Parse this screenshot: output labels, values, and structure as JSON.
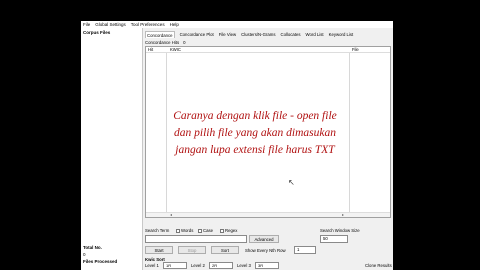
{
  "menu": [
    "File",
    "Global Settings",
    "Tool Preferences",
    "Help"
  ],
  "left_panel": {
    "corpus_title": "Corpus Files",
    "total_label": "Total No.",
    "total_value": "0",
    "files_processed": "Files Processed"
  },
  "tabs": [
    "Concordance",
    "Concordance Plot",
    "File View",
    "Clusters/N-Grams",
    "Collocates",
    "Word List",
    "Keyword List"
  ],
  "hits": {
    "label": "Concordance Hits",
    "value": "0"
  },
  "columns": {
    "hit": "Hit",
    "kwic": "KWIC",
    "file": "File"
  },
  "overlay": [
    "Caranya dengan klik file - open file",
    "dan pilih file yang akan dimasukan",
    "jangan lupa extensi file harus TXT"
  ],
  "search": {
    "label": "Search Term",
    "words": "Words",
    "case": "Case",
    "regex": "Regex",
    "advanced": "Advanced",
    "start": "Start",
    "stop": "Stop",
    "sort": "Sort",
    "show_every": "Show Every Nth Row",
    "nth_value": "1"
  },
  "window": {
    "label": "Search Window Size",
    "value": "50"
  },
  "kwic_sort": {
    "label": "Kwic Sort",
    "level1": "Level 1",
    "level1_val": "1R",
    "level2": "Level 2",
    "level2_val": "2R",
    "level3": "Level 3",
    "level3_val": "3R",
    "clone": "Clone Results"
  }
}
